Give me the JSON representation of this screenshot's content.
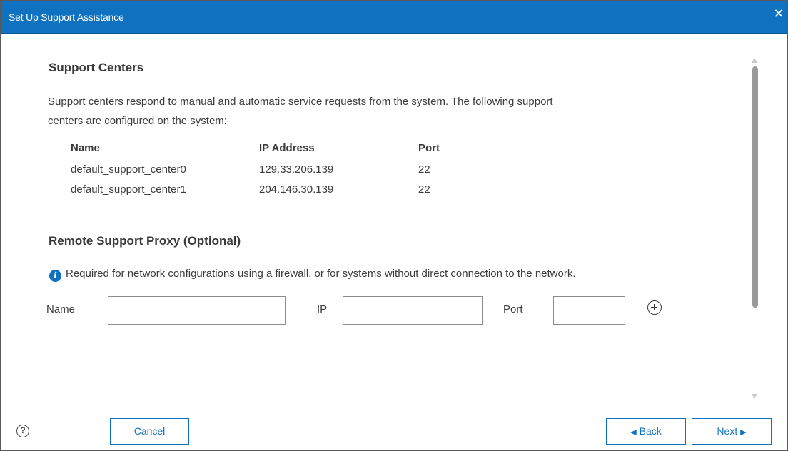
{
  "dialog": {
    "title": "Set Up Support Assistance",
    "close_glyph": "✕"
  },
  "support_centers": {
    "heading": "Support Centers",
    "description_line1": "Support centers respond to manual and automatic service requests from the system. The following support",
    "description_line2": "centers are configured on the system:",
    "columns": [
      "Name",
      "IP Address",
      "Port"
    ],
    "rows": [
      {
        "name": "default_support_center0",
        "ip": "129.33.206.139",
        "port": "22"
      },
      {
        "name": "default_support_center1",
        "ip": "204.146.30.139",
        "port": "22"
      }
    ]
  },
  "proxy": {
    "heading": "Remote Support Proxy (Optional)",
    "info_text": "Required for network configurations using a firewall, or for systems without direct connection to the network.",
    "info_glyph": "i",
    "name_label": "Name",
    "name_value": "",
    "ip_label": "IP",
    "ip_value": "",
    "port_label": "Port",
    "port_value": ""
  },
  "footer": {
    "help_glyph": "?",
    "cancel_label": "Cancel",
    "back_label": "Back",
    "back_arrow": "◀",
    "next_label": "Next",
    "next_arrow": "▶"
  },
  "icons": {
    "info": "info-icon",
    "add": "add-circle-icon",
    "help": "help-icon",
    "close": "close-icon"
  },
  "colors": {
    "accent": "#0f72c0",
    "title_text": "#ffffff",
    "body_text": "#3c3c3c"
  }
}
